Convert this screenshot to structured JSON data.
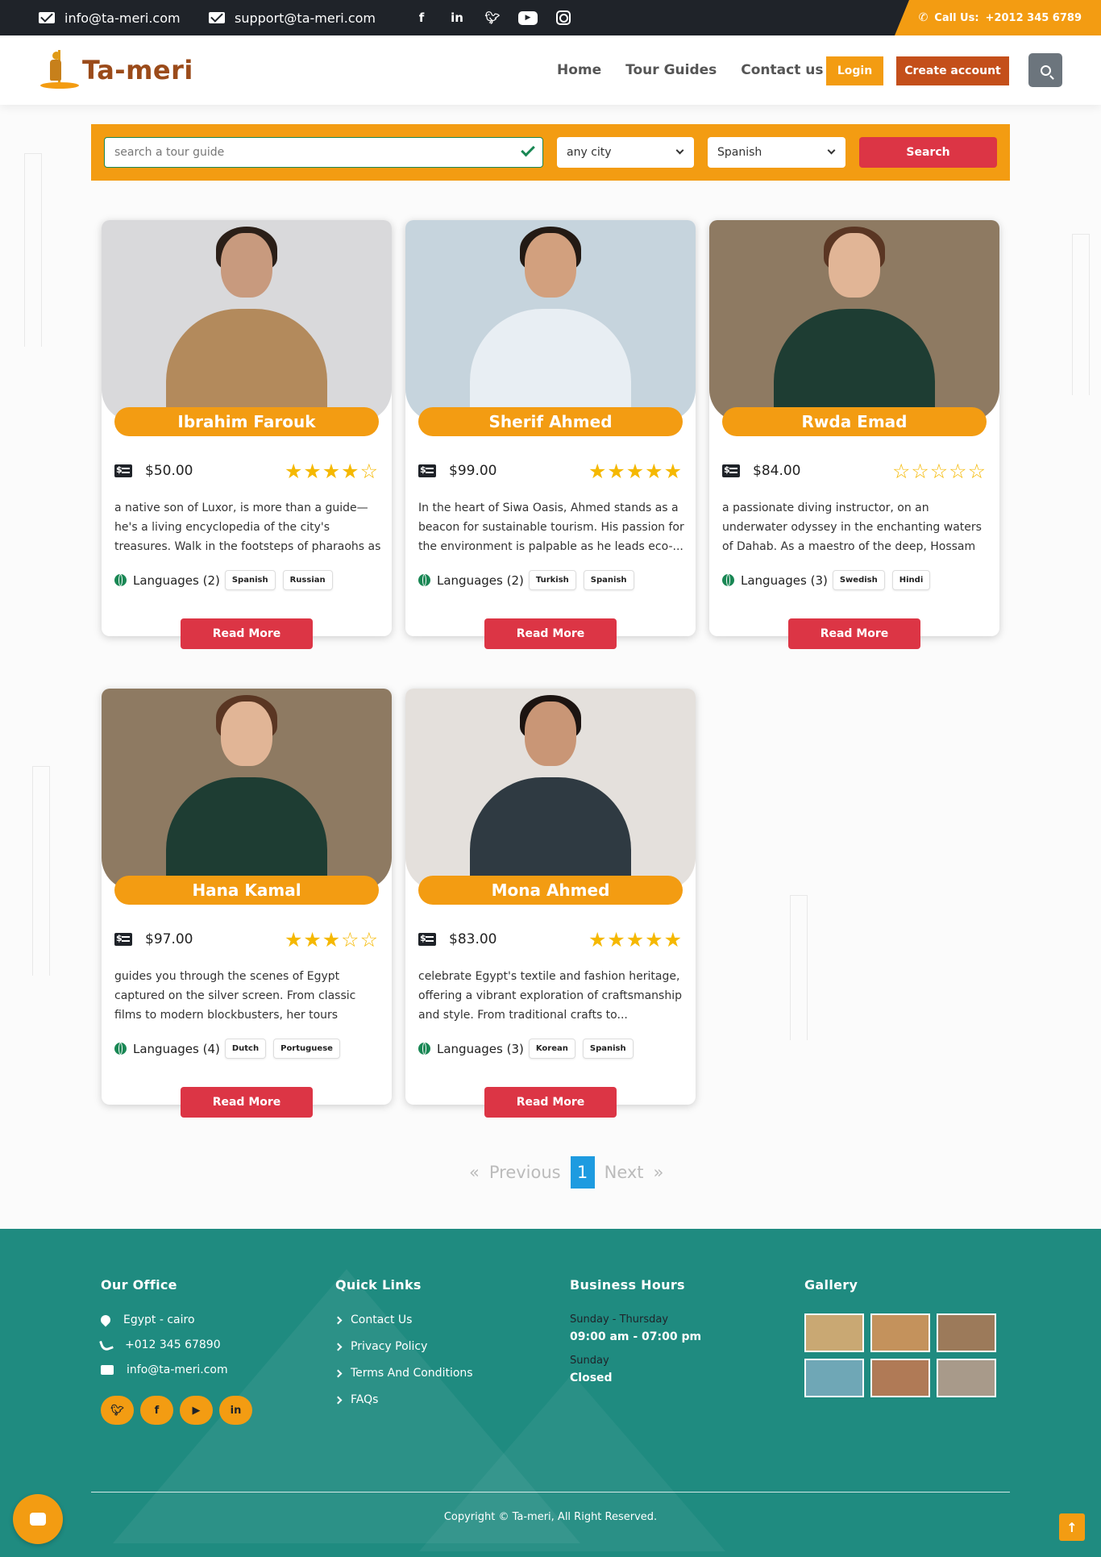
{
  "topbar": {
    "email_info": "info@ta-meri.com",
    "email_support": "support@ta-meri.com",
    "socials": [
      "facebook-icon",
      "linkedin-icon",
      "twitter-icon",
      "youtube-icon",
      "instagram-icon"
    ],
    "call_label": "Call Us:",
    "call_number": "+2012 345 6789"
  },
  "navbar": {
    "logo_text": "Ta-meri",
    "links": [
      "Home",
      "Tour Guides",
      "Contact us"
    ],
    "login_label": "Login",
    "create_label": "Create account"
  },
  "search": {
    "placeholder": "search a tour guide",
    "city_value": "any city",
    "language_value": "Spanish",
    "button_label": "Search"
  },
  "guides": [
    {
      "name": "Ibrahim Farouk",
      "price": "$50.00",
      "rating": 4,
      "description": "a native son of Luxor, is more than a guide—he's a living encyclopedia of the city's treasures. Walk in the footsteps of pharaohs as Youssef unfolds...",
      "languages_label": "Languages (2)",
      "languages": [
        "Spanish",
        "Russian"
      ],
      "read_more": "Read More",
      "colors": {
        "bg": "#d9d9db",
        "skin": "#c89a7e",
        "hair": "#2b1f18",
        "body": "#b38a5c"
      }
    },
    {
      "name": "Sherif Ahmed",
      "price": "$99.00",
      "rating": 5,
      "description": "In the heart of Siwa Oasis, Ahmed stands as a beacon for sustainable tourism. His passion for the environment is palpable as he leads eco-...",
      "languages_label": "Languages (2)",
      "languages": [
        "Turkish",
        "Spanish"
      ],
      "read_more": "Read More",
      "colors": {
        "bg": "#c6d4dd",
        "skin": "#d2a07e",
        "hair": "#231a14",
        "body": "#e8eef3"
      }
    },
    {
      "name": "Rwda Emad",
      "price": "$84.00",
      "rating": 0,
      "description": "a passionate diving instructor, on an underwater odyssey in the enchanting waters of Dahab. As a maestro of the deep, Hossam not only unveils...",
      "languages_label": "Languages (3)",
      "languages": [
        "Swedish",
        "Hindi"
      ],
      "read_more": "Read More",
      "colors": {
        "bg": "#8e7a62",
        "skin": "#e1b596",
        "hair": "#5a3623",
        "body": "#1e3d33"
      }
    },
    {
      "name": "Hana Kamal",
      "price": "$97.00",
      "rating": 3,
      "description": "guides you through the scenes of Egypt captured on the silver screen. From classic films to modern blockbusters, her tours showcase th...",
      "languages_label": "Languages (4)",
      "languages": [
        "Dutch",
        "Portuguese"
      ],
      "read_more": "Read More",
      "colors": {
        "bg": "#8e7a62",
        "skin": "#e1b596",
        "hair": "#5a3623",
        "body": "#1e3d33"
      }
    },
    {
      "name": "Mona Ahmed",
      "price": "$83.00",
      "rating": 5,
      "description": "celebrate Egypt's textile and fashion heritage, offering a vibrant exploration of craftsmanship and style. From traditional crafts to...",
      "languages_label": "Languages (3)",
      "languages": [
        "Korean",
        "Spanish"
      ],
      "read_more": "Read More",
      "colors": {
        "bg": "#e4e0dc",
        "skin": "#c99676",
        "hair": "#1c1411",
        "body": "#2f3a42"
      }
    }
  ],
  "pagination": {
    "first": "«",
    "previous": "Previous",
    "current": "1",
    "next": "Next",
    "last": "»"
  },
  "footer": {
    "office_title": "Our Office",
    "address": "Egypt - cairo",
    "phone": "+012 345 67890",
    "email": "info@ta-meri.com",
    "socials": [
      "twitter-icon",
      "facebook-icon",
      "youtube-icon",
      "linkedin-icon"
    ],
    "links_title": "Quick Links",
    "links": [
      "Contact Us",
      "Privacy Policy",
      "Terms And Conditions",
      "FAQs"
    ],
    "hours_title": "Business Hours",
    "hours": [
      {
        "days": "Sunday - Thursday",
        "time": "09:00 am - 07:00 pm"
      },
      {
        "days": "Sunday",
        "time": "Closed"
      }
    ],
    "gallery_title": "Gallery",
    "gallery_colors": [
      "#c9a873",
      "#c4925c",
      "#9c7a5a",
      "#6fa7b6",
      "#b07a56",
      "#a89a8a"
    ],
    "copyright": "Copyright © Ta-meri, All Right Reserved."
  }
}
